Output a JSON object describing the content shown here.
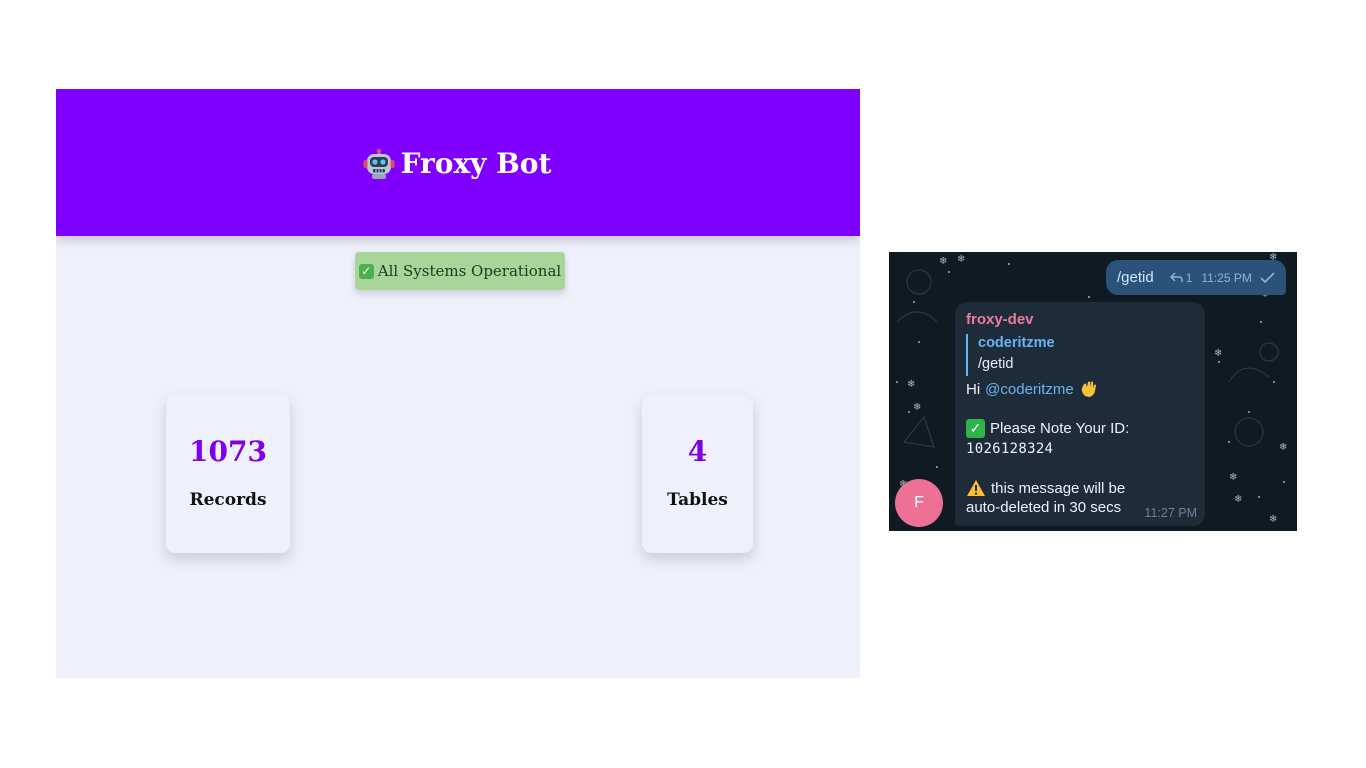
{
  "dashboard": {
    "title": "Froxy Bot",
    "title_icon": "robot-icon",
    "status": "All Systems Operational",
    "status_icon": "check-mark-icon",
    "stats": [
      {
        "value": "1073",
        "label": "Records"
      },
      {
        "value": "4",
        "label": "Tables"
      }
    ],
    "colors": {
      "header_bg": "#7f00ff",
      "page_bg": "#eef0fc",
      "status_bg": "#a8d59a",
      "stat_value": "#7f00e6"
    }
  },
  "chat": {
    "outgoing": {
      "text": "/getid",
      "reply_count": "1",
      "time": "11:25 PM"
    },
    "incoming": {
      "sender": "froxy-dev",
      "quote_author": "coderitzme",
      "quote_text": "/getid",
      "greeting": "Hi",
      "mention": "@coderitzme",
      "greeting_emoji": "waving-hand-icon",
      "note_label": "Please Note Your ID:",
      "user_id": "1026128324",
      "warning_line1": "this message will be",
      "warning_line2": "auto-deleted in 30 secs",
      "time": "11:27 PM"
    },
    "avatar_letter": "F",
    "colors": {
      "background": "#0f1a22",
      "outgoing_bubble": "#2b5278",
      "incoming_bubble": "#1e2c3a",
      "sender_name": "#ee7aa0",
      "link": "#6ab3f3",
      "avatar": "#ec7195"
    }
  }
}
